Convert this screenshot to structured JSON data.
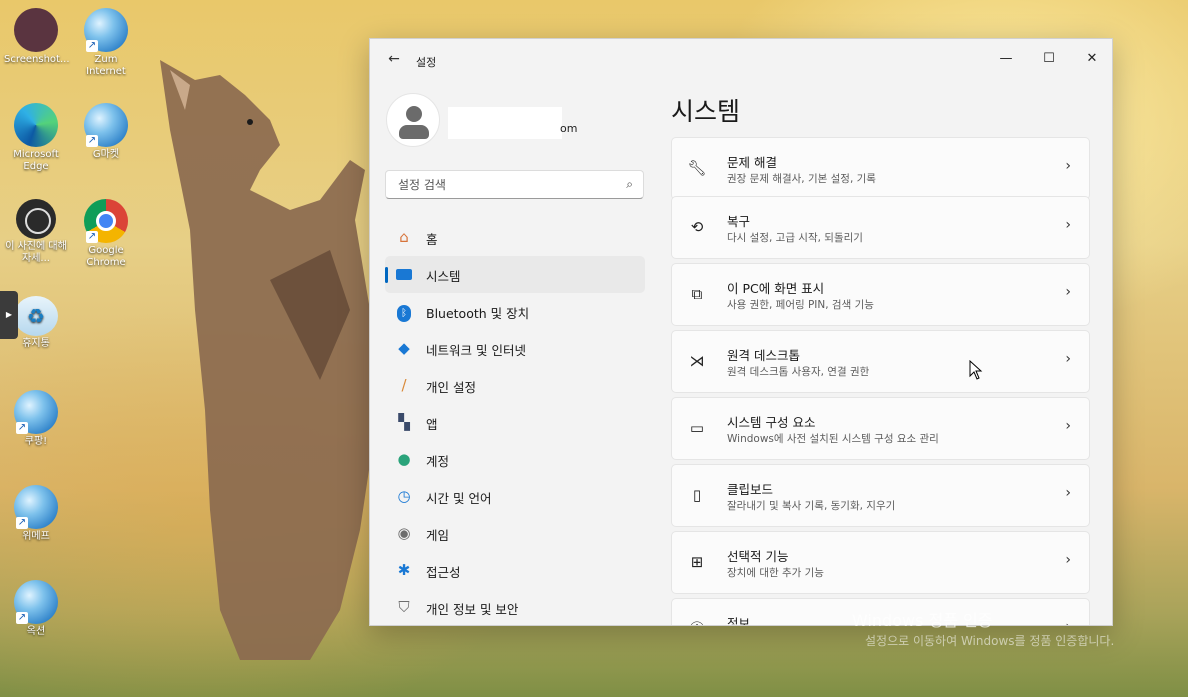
{
  "desktop": {
    "icons": [
      {
        "label": "Screenshot...",
        "icon": "screenshot-file-icon"
      },
      {
        "label": "Zum Internet",
        "icon": "globe-shortcut-icon"
      },
      {
        "label": "Microsoft Edge",
        "icon": "edge-icon"
      },
      {
        "label": "G마켓",
        "icon": "globe-shortcut-icon"
      },
      {
        "label": "이 사진에 대해 자세...",
        "icon": "photo-info-icon"
      },
      {
        "label": "Google Chrome",
        "icon": "chrome-icon"
      },
      {
        "label": "휴지통",
        "icon": "recycle-bin-icon"
      },
      {
        "label": "쿠팡!",
        "icon": "globe-shortcut-icon"
      },
      {
        "label": "위메프",
        "icon": "globe-shortcut-icon"
      },
      {
        "label": "옥션",
        "icon": "globe-shortcut-icon"
      }
    ],
    "watermark": "Windows 정품 인증",
    "watermark_sub": "설정으로 이동하여 Windows를 정품 인증합니다."
  },
  "window": {
    "title": "설정",
    "controls": {
      "minimize": "—",
      "maximize": "☐",
      "close": "✕"
    },
    "account": {
      "email_suffix": "om"
    },
    "search": {
      "placeholder": "설정 검색"
    },
    "nav": [
      {
        "label": "홈",
        "icon": "home-icon",
        "active": false
      },
      {
        "label": "시스템",
        "icon": "system-display-icon",
        "active": true
      },
      {
        "label": "Bluetooth 및 장치",
        "icon": "bluetooth-icon",
        "active": false
      },
      {
        "label": "네트워크 및 인터넷",
        "icon": "network-icon",
        "active": false
      },
      {
        "label": "개인 설정",
        "icon": "paintbrush-icon",
        "active": false
      },
      {
        "label": "앱",
        "icon": "apps-icon",
        "active": false
      },
      {
        "label": "계정",
        "icon": "account-icon",
        "active": false
      },
      {
        "label": "시간 및 언어",
        "icon": "time-language-icon",
        "active": false
      },
      {
        "label": "게임",
        "icon": "gamepad-icon",
        "active": false
      },
      {
        "label": "접근성",
        "icon": "accessibility-icon",
        "active": false
      },
      {
        "label": "개인 정보 및 보안",
        "icon": "shield-icon",
        "active": false
      }
    ],
    "page_title": "시스템",
    "cards": [
      {
        "title": "문제 해결",
        "subtitle": "권장 문제 해결사, 기본 설정, 기록",
        "icon": "wrench-icon"
      },
      {
        "title": "복구",
        "subtitle": "다시 설정, 고급 시작, 되돌리기",
        "icon": "recovery-icon"
      },
      {
        "title": "이 PC에 화면 표시",
        "subtitle": "사용 권한, 페어링 PIN, 검색 기능",
        "icon": "project-screen-icon"
      },
      {
        "title": "원격 데스크톱",
        "subtitle": "원격 데스크톱 사용자, 연결 권한",
        "icon": "remote-desktop-icon"
      },
      {
        "title": "시스템 구성 요소",
        "subtitle": "Windows에 사전 설치된 시스템 구성 요소 관리",
        "icon": "components-icon"
      },
      {
        "title": "클립보드",
        "subtitle": "잘라내기 및 복사 기록, 동기화, 지우기",
        "icon": "clipboard-icon"
      },
      {
        "title": "선택적 기능",
        "subtitle": "장치에 대한 추가 기능",
        "icon": "optional-features-icon"
      },
      {
        "title": "정보",
        "subtitle": "",
        "icon": "info-icon"
      }
    ],
    "accent": "#0067c0"
  }
}
